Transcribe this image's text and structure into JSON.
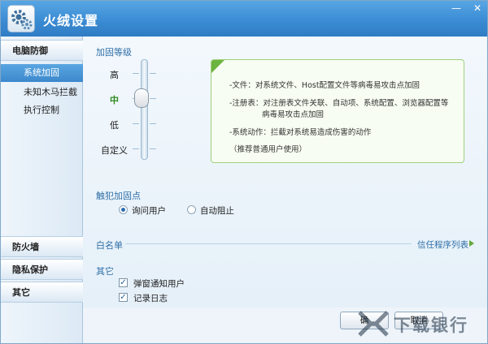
{
  "window": {
    "title": "火绒设置",
    "buttons": {
      "minimize": "—",
      "close": "✕"
    }
  },
  "sidebar": {
    "categories": [
      {
        "label": "电脑防御"
      },
      {
        "label": "防火墙"
      },
      {
        "label": "隐私保护"
      },
      {
        "label": "其它"
      }
    ],
    "subitems": [
      {
        "label": "系统加固",
        "active": true
      },
      {
        "label": "未知木马拦截",
        "active": false
      },
      {
        "label": "执行控制",
        "active": false
      }
    ]
  },
  "hardening": {
    "section_label": "加固等级",
    "levels": [
      {
        "label": "高",
        "selected": false
      },
      {
        "label": "中",
        "selected": true
      },
      {
        "label": "低",
        "selected": false
      },
      {
        "label": "自定义",
        "selected": false
      }
    ],
    "description": [
      "-文件：对系统文件、Host配置文件等病毒易攻击点加固",
      "-注册表：对注册表文件关联、自动项、系统配置、浏览器配置等",
      "病毒易攻击点加固",
      "-系统动作：拦截对系统易造成伤害的动作",
      "（推荐普通用户使用）"
    ]
  },
  "violation": {
    "section_label": "触犯加固点",
    "options": [
      {
        "label": "询问用户",
        "selected": true
      },
      {
        "label": "自动阻止",
        "selected": false
      }
    ]
  },
  "whitelist": {
    "section_label": "白名单",
    "link_label": "信任程序列表"
  },
  "other": {
    "section_label": "其它",
    "checkboxes": [
      {
        "label": "弹窗通知用户",
        "checked": true
      },
      {
        "label": "记录日志",
        "checked": true
      }
    ]
  },
  "footer": {
    "ok_label": "确",
    "cancel_label": "取消",
    "watermark_text": "下载银行"
  },
  "colors": {
    "titlebar": "#3b8cd4",
    "accent_blue": "#2f6fa8",
    "accent_green": "#6db33f",
    "selected_level": "#2e8a1e"
  }
}
